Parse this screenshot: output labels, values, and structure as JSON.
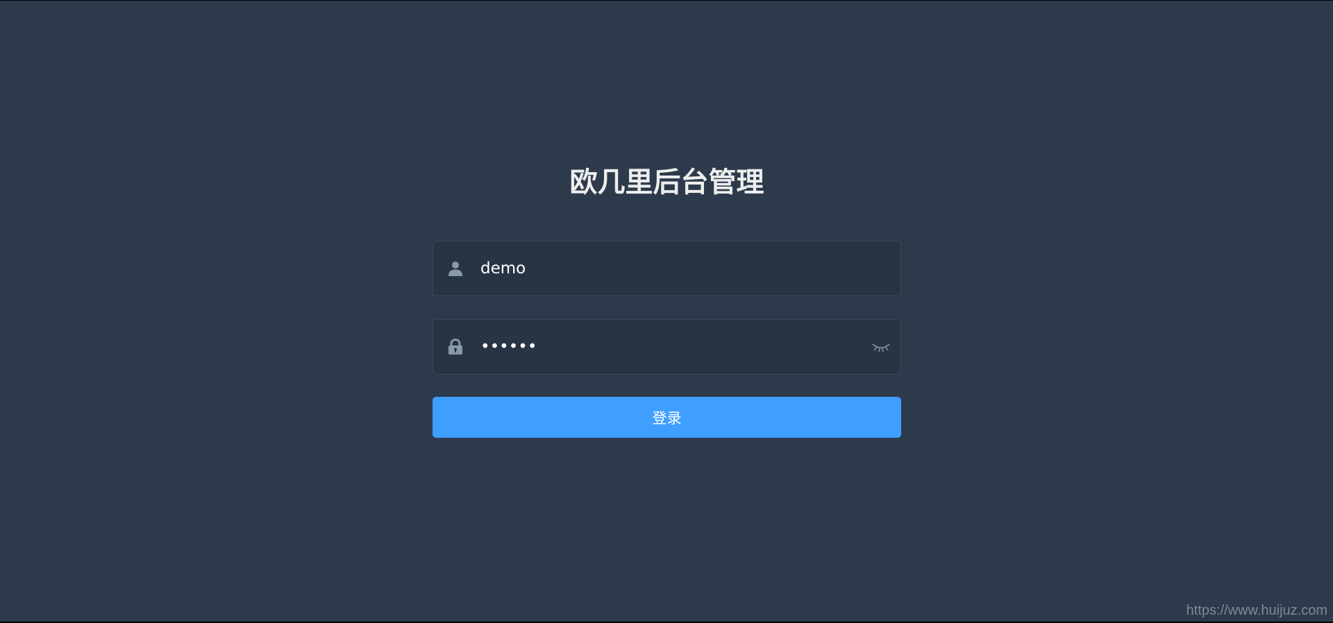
{
  "login": {
    "title": "欧几里后台管理",
    "username": {
      "icon": "user-icon",
      "value": "demo"
    },
    "password": {
      "icon": "lock-icon",
      "value": "••••••",
      "toggle_icon": "eye-closed-icon"
    },
    "submit_label": "登录"
  },
  "watermark": "https://www.huijuz.com",
  "colors": {
    "background": "#2d3a4b",
    "input_background": "#283443",
    "accent": "#409eff",
    "icon": "#889aa4"
  }
}
